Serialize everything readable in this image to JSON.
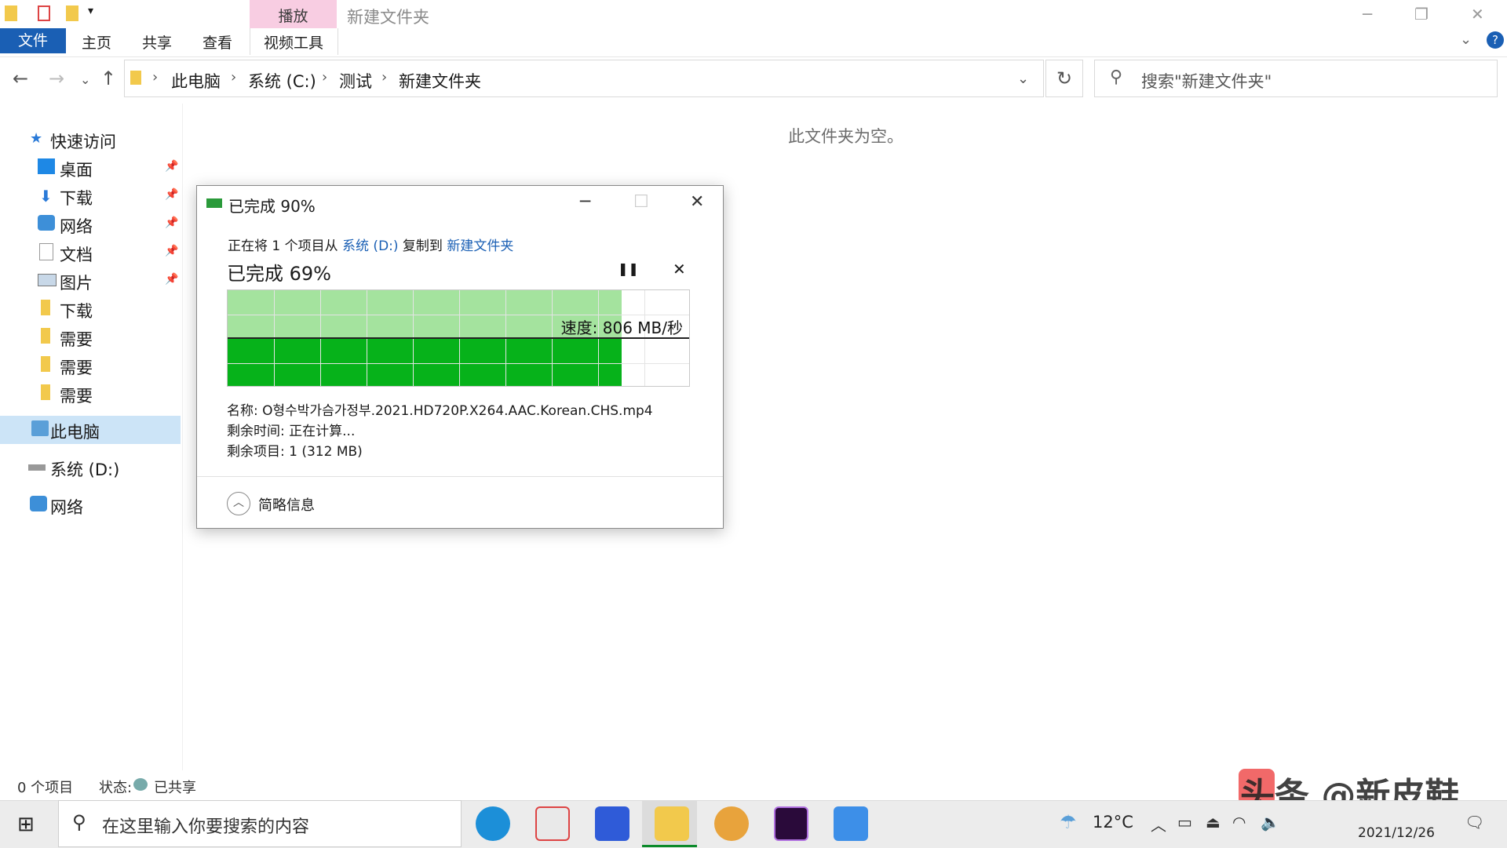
{
  "window": {
    "context_tab": "播放",
    "title": "新建文件夹",
    "tabs": [
      "文件",
      "主页",
      "共享",
      "查看",
      "视频工具"
    ]
  },
  "address": {
    "crumbs": [
      "此电脑",
      "系统 (C:)",
      "测试",
      "新建文件夹"
    ],
    "search_placeholder": "搜索\"新建文件夹\""
  },
  "sidebar": {
    "items": [
      {
        "label": "快速访问"
      },
      {
        "label": "桌面"
      },
      {
        "label": "下载"
      },
      {
        "label": "网络"
      },
      {
        "label": "文档"
      },
      {
        "label": "图片"
      },
      {
        "label": "下载"
      },
      {
        "label": "需要"
      },
      {
        "label": "需要"
      },
      {
        "label": "需要"
      },
      {
        "label": "此电脑"
      },
      {
        "label": "系统 (D:)"
      },
      {
        "label": "网络"
      }
    ]
  },
  "content": {
    "empty_text": "此文件夹为空。"
  },
  "statusbar": {
    "count": "0 个项目",
    "state_label": "状态:",
    "state_value": "已共享"
  },
  "dialog": {
    "title": "已完成 90%",
    "line_prefix": "正在将 1 个项目从 ",
    "source": "系统 (D:)",
    "line_mid": " 复制到 ",
    "dest": "新建文件夹",
    "percent_text": "已完成 69%",
    "progress_fraction": 0.85,
    "speed": "速度: 806 MB/秒",
    "name_line": "名称: O형수박가슴가정부.2021.HD720P.X264.AAC.Korean.CHS.mp4",
    "time_line": "剩余时间: 正在计算...",
    "items_line": "剩余项目: 1 (312 MB)",
    "details_label": "简略信息"
  },
  "taskbar": {
    "search_placeholder": "在这里输入你要搜索的内容",
    "temperature": "12°C",
    "date": "2021/12/26"
  },
  "watermark": "头条 @新皮鞋",
  "colors": {
    "accent": "#1a5fb4",
    "progress_dark": "#06b21a",
    "progress_light": "#a4e39e",
    "context_tab": "#f8cde2"
  }
}
